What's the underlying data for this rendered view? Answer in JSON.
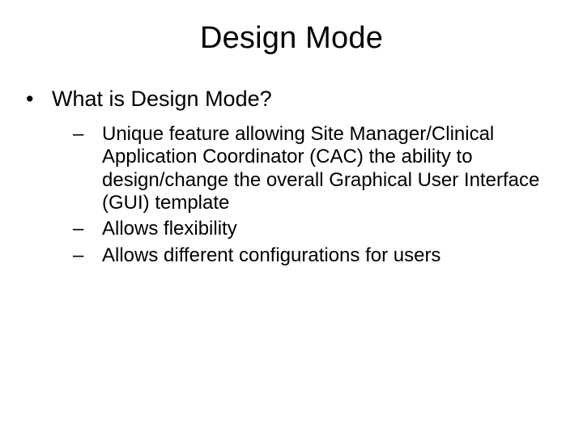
{
  "title": "Design Mode",
  "level1": {
    "bullet_char": "•",
    "text": "What is Design Mode?"
  },
  "level2": {
    "dash_char": "–",
    "items": [
      "Unique feature allowing Site Manager/Clinical Application Coordinator (CAC) the ability to design/change the overall Graphical User Interface (GUI) template",
      "Allows flexibility",
      "Allows different configurations for users"
    ]
  }
}
